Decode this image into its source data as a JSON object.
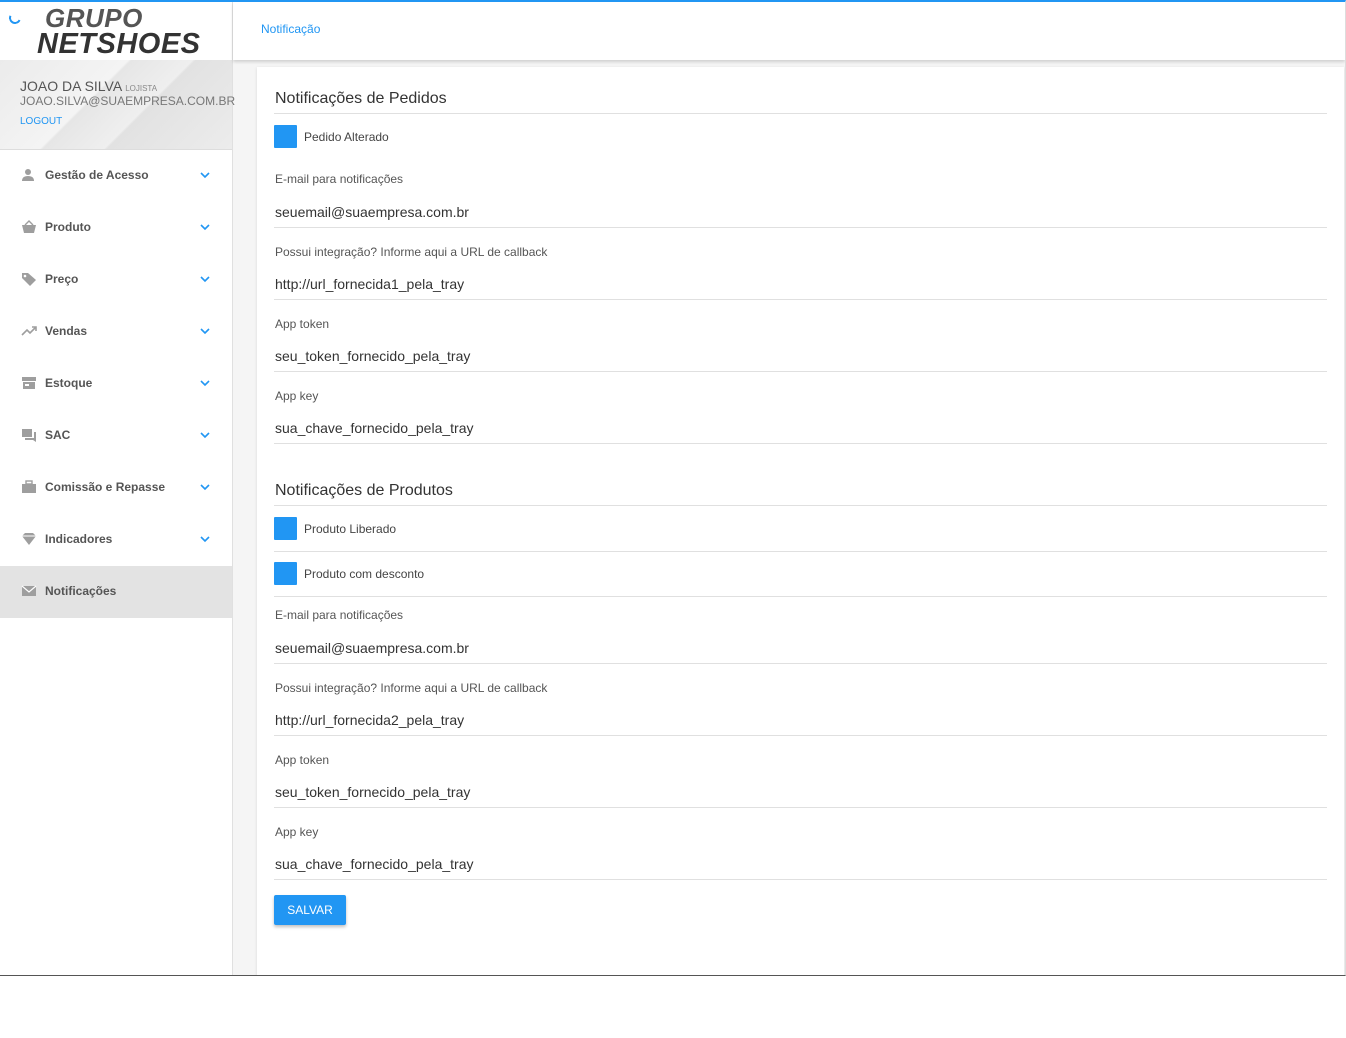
{
  "logo": {
    "line1": "GRUPO",
    "line2": "NETSHOES"
  },
  "user": {
    "name": "JOAO DA SILVA",
    "role": "LOJISTA",
    "email": "JOAO.SILVA@SUAEMPRESA.COM.BR",
    "logout_label": "LOGOUT"
  },
  "sidebar": {
    "items": [
      {
        "label": "Gestão de Acesso",
        "icon": "person-icon"
      },
      {
        "label": "Produto",
        "icon": "basket-icon"
      },
      {
        "label": "Preço",
        "icon": "tag-icon"
      },
      {
        "label": "Vendas",
        "icon": "trending-up-icon"
      },
      {
        "label": "Estoque",
        "icon": "warehouse-icon"
      },
      {
        "label": "SAC",
        "icon": "chat-icon"
      },
      {
        "label": "Comissão e Repasse",
        "icon": "briefcase-icon"
      },
      {
        "label": "Indicadores",
        "icon": "diamond-icon"
      },
      {
        "label": "Notificações",
        "icon": "mail-icon",
        "active": true
      }
    ]
  },
  "breadcrumb": "Notificação",
  "pedidos": {
    "title": "Notificações de Pedidos",
    "checkbox_label": "Pedido Alterado",
    "email_label": "E-mail para notificações",
    "email_value": "seuemail@suaempresa.com.br",
    "callback_label": "Possui integração? Informe aqui a URL de callback",
    "callback_value": "http://url_fornecida1_pela_tray",
    "token_label": "App token",
    "token_value": "seu_token_fornecido_pela_tray",
    "key_label": "App key",
    "key_value": "sua_chave_fornecido_pela_tray"
  },
  "produtos": {
    "title": "Notificações de Produtos",
    "checkbox1_label": "Produto Liberado",
    "checkbox2_label": "Produto com desconto",
    "email_label": "E-mail para notificações",
    "email_value": "seuemail@suaempresa.com.br",
    "callback_label": "Possui integração? Informe aqui a URL de callback",
    "callback_value": "http://url_fornecida2_pela_tray",
    "token_label": "App token",
    "token_value": "seu_token_fornecido_pela_tray",
    "key_label": "App key",
    "key_value": "sua_chave_fornecido_pela_tray"
  },
  "save_label": "SALVAR",
  "colors": {
    "accent": "#2196f3",
    "active_nav_bg": "#e3e3e3"
  }
}
